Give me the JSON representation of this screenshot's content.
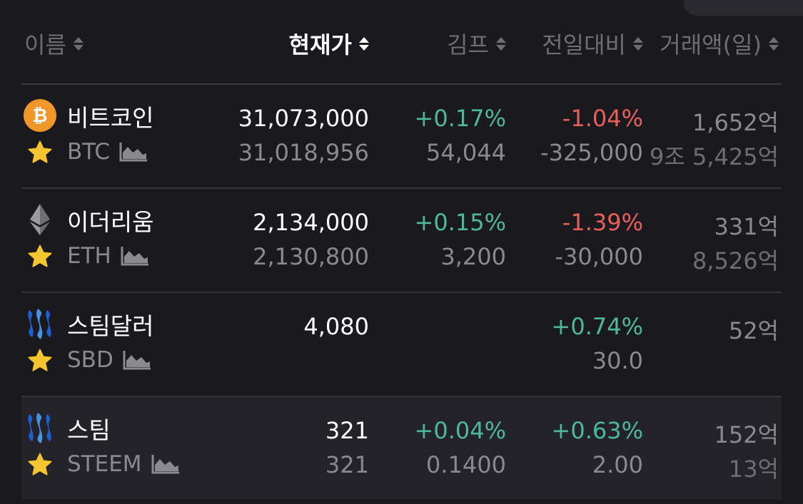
{
  "header": {
    "name_label": "이름",
    "price_label": "현재가",
    "kimp_label": "김프",
    "change_label": "전일대비",
    "volume_label": "거래액(일)"
  },
  "colors": {
    "up": "#4db89a",
    "down": "#e8605a",
    "star": "#f5c531",
    "btc": "#f0972b"
  },
  "rows": [
    {
      "icon": "bitcoin-icon",
      "name": "비트코인",
      "symbol": "BTC",
      "price": "31,073,000",
      "price_sub": "31,018,956",
      "kimp": "+0.17%",
      "kimp_sub": "54,044",
      "change": "-1.04%",
      "change_sub": "-325,000",
      "volume": "1,652억",
      "volume_sub": "9조 5,425억"
    },
    {
      "icon": "ethereum-icon",
      "name": "이더리움",
      "symbol": "ETH",
      "price": "2,134,000",
      "price_sub": "2,130,800",
      "kimp": "+0.15%",
      "kimp_sub": "3,200",
      "change": "-1.39%",
      "change_sub": "-30,000",
      "volume": "331억",
      "volume_sub": "8,526억"
    },
    {
      "icon": "steem-icon",
      "name": "스팀달러",
      "symbol": "SBD",
      "price": "4,080",
      "price_sub": "",
      "kimp": "",
      "kimp_sub": "",
      "change": "+0.74%",
      "change_sub": "30.0",
      "volume": "52억",
      "volume_sub": ""
    },
    {
      "icon": "steem-icon",
      "name": "스팀",
      "symbol": "STEEM",
      "price": "321",
      "price_sub": "321",
      "kimp": "+0.04%",
      "kimp_sub": "0.1400",
      "change": "+0.63%",
      "change_sub": "2.00",
      "volume": "152억",
      "volume_sub": "13억"
    }
  ]
}
